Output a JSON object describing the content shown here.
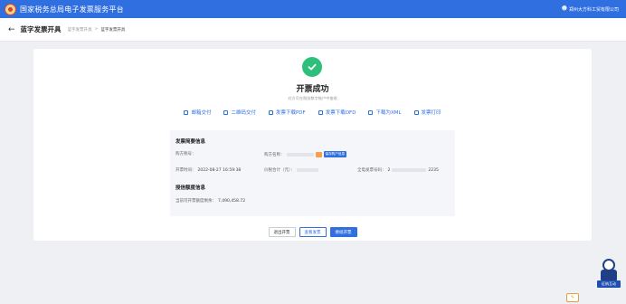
{
  "header": {
    "title": "国家税务总局电子发票服务平台",
    "user_name": "郑州大方科工贸有限公司"
  },
  "breadcrumb": {
    "page_title": "蓝字发票开具",
    "items": [
      "蓝字发票开具",
      "蓝字发票开具"
    ]
  },
  "result": {
    "title": "开票成功",
    "subtitle": "对方可在税务数字账户中查收"
  },
  "actions": [
    {
      "label": "邮箱交付",
      "icon": "mail-icon"
    },
    {
      "label": "二维码交付",
      "icon": "qrcode-icon"
    },
    {
      "label": "发票下载PDF",
      "icon": "download-icon"
    },
    {
      "label": "发票下载OFD",
      "icon": "download-icon"
    },
    {
      "label": "下载为XML",
      "icon": "download-icon"
    },
    {
      "label": "发票打印",
      "icon": "print-icon"
    }
  ],
  "invoice_info": {
    "section_title": "发票简要信息",
    "buyer_tax_no_label": "购方税号：",
    "buyer_name_label": "购方名称：",
    "save_buyer_btn": "保存购户信息",
    "issue_time_label": "开票时间：",
    "issue_time_value": "2022-08-27 16:59:38",
    "total_label": "价税合计（元）：",
    "invoice_no_label": "全电发票号码：",
    "invoice_no_prefix": "2",
    "invoice_no_suffix": "2235"
  },
  "credit_info": {
    "section_title": "授信额度信息",
    "remaining_label": "当前可开票额度剩余：",
    "remaining_value": "7,490,458.72"
  },
  "buttons": {
    "exit": "退出开票",
    "view": "查看发票",
    "continue": "继续开票"
  },
  "assistant": {
    "label": "征纳互动"
  },
  "colors": {
    "primary": "#2f6fe0",
    "success": "#2ebf7a",
    "page_bg": "#eef0f4"
  }
}
